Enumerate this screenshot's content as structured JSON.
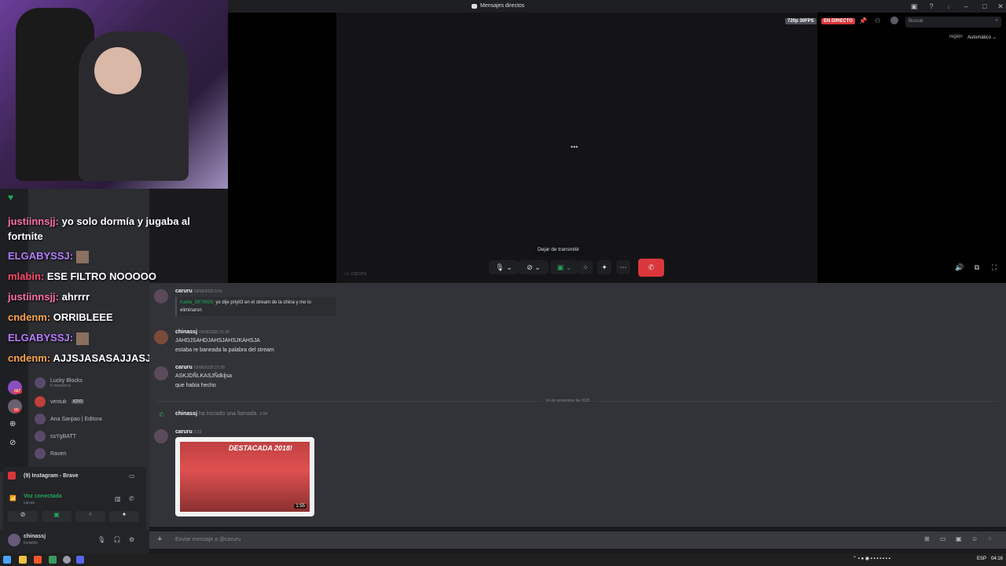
{
  "window": {
    "title": "Mensajes directos"
  },
  "stream": {
    "quality_badge": "720p 30FPS",
    "live_badge": "EN DIRECTO",
    "region_label": "región",
    "region_value": "Automático",
    "search_placeholder": "Buscar",
    "stream_owner_label": "caruru",
    "loading": "•••"
  },
  "controls": {
    "tooltip": "Dejar de transmitir"
  },
  "stream_chat": [
    {
      "user": "justiinnsjj:",
      "text": "yo solo dormía y jugaba al fortnite",
      "color": "#ff6fa5"
    },
    {
      "user": "ELGABYSSJ:",
      "text": "",
      "color": "#b57cff"
    },
    {
      "user": "mlabin:",
      "text": "ESE FILTRO NOOOOO",
      "color": "#ff4a6a"
    },
    {
      "user": "justiinnsjj:",
      "text": "ahrrrr",
      "color": "#ff6fa5"
    },
    {
      "user": "cndenm:",
      "text": "ORRIBLEEE",
      "color": "#ffa54a"
    },
    {
      "user": "ELGABYSSJ:",
      "text": "",
      "color": "#b57cff"
    },
    {
      "user": "cndenm:",
      "text": "AJJSJASASAJJASJ",
      "color": "#ffa54a"
    }
  ],
  "sidebar": {
    "dms": [
      {
        "name": "Lucky Blocks",
        "sub": "5 miembros"
      },
      {
        "name": "ventuk",
        "sub": "",
        "tag": "X2V2"
      },
      {
        "name": "Ana Sanjiao | Editora",
        "sub": ""
      },
      {
        "name": "ѕѕYgBATT",
        "sub": ""
      },
      {
        "name": "Raven",
        "sub": ""
      }
    ],
    "server_badges": [
      "887",
      "90"
    ],
    "activity": {
      "title": "(9) Instagram - Brave"
    },
    "voice": {
      "status": "Voz conectada",
      "channel": "caruru"
    },
    "user": {
      "name": "chinassj",
      "status": "Invisible"
    }
  },
  "messages": [
    {
      "author": "caruru",
      "time": "03/06/2025 0:01",
      "quote_user": "Katita_5878999:",
      "quote_text": "yo dije priyit3 en el stream de la china y me lo eliminaron"
    },
    {
      "author": "chinassj",
      "time": "03/06/2025 21:25",
      "lines": [
        "JAHDJSAHDJAHSJAHSJKAHSJA",
        "estaba re baneada la palabra del stream"
      ]
    },
    {
      "author": "caruru",
      "time": "03/06/2025 21:30",
      "lines": [
        "ASKJDÑLKASJÑdkljsa",
        "que habia hecho"
      ]
    }
  ],
  "date_divider": "14 de noviembre de 2025",
  "call_event": {
    "user": "chinassj",
    "text": "ha iniciado una llamada.",
    "time": "2:04"
  },
  "last_message": {
    "author": "caruru",
    "time": "3:22",
    "image_caption": "DESTACADA 2018!",
    "video_duration": "1:55"
  },
  "composer": {
    "placeholder": "Enviar mensaje a @caruru"
  },
  "taskbar": {
    "lang": "ESP",
    "time": "04:16"
  }
}
